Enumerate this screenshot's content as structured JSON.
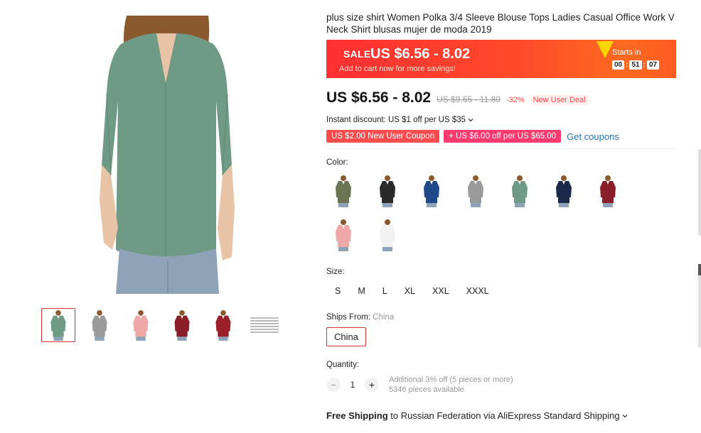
{
  "product": {
    "title": "plus size shirt Women Polka 3/4 Sleeve Blouse Tops Ladies Casual Office Work V Neck Shirt blusas mujer de moda 2019"
  },
  "sale": {
    "tag": "SALE",
    "price": "US $6.56 - 8.02",
    "subtitle": "Add to cart now for more savings!",
    "starts_in": "Starts in",
    "countdown": [
      "00",
      "51",
      "07"
    ]
  },
  "price": {
    "current": "US $6.56 - 8.02",
    "original": "US $9.65 - 11.80",
    "discount": "-32%",
    "deal": "New User Deal"
  },
  "instant_discount": "Instant discount: US $1 off per US $35",
  "coupons": {
    "new_user": "US $2.00 New User Coupon",
    "store": "+ US $6.00 off per US $65.00",
    "get": "Get coupons"
  },
  "color": {
    "label": "Color:",
    "options": [
      {
        "name": "army-green",
        "hex": "#6b7553"
      },
      {
        "name": "black",
        "hex": "#2a2a2a"
      },
      {
        "name": "royal-blue",
        "hex": "#1e4a8a"
      },
      {
        "name": "gray",
        "hex": "#9a9a9a"
      },
      {
        "name": "sage-green",
        "hex": "#6f9a86"
      },
      {
        "name": "navy",
        "hex": "#1b2a4a"
      },
      {
        "name": "wine-red",
        "hex": "#8a1f2a"
      },
      {
        "name": "pink",
        "hex": "#f0a7a7"
      },
      {
        "name": "white",
        "hex": "#f2f2f2"
      }
    ]
  },
  "size": {
    "label": "Size:",
    "options": [
      "S",
      "M",
      "L",
      "XL",
      "XXL",
      "XXXL"
    ]
  },
  "ships_from": {
    "label": "Ships From:",
    "value": "China",
    "button": "China"
  },
  "quantity": {
    "label": "Quantity:",
    "value": "1",
    "minus": "−",
    "plus": "+",
    "offer": "Additional 3% off (5 pieces or more)",
    "available": "5346 pieces available"
  },
  "shipping": {
    "bold": "Free Shipping",
    "rest": " to Russian Federation via AliExpress Standard Shipping"
  },
  "gallery": {
    "main_color": "#6f9a86",
    "thumbs": [
      {
        "name": "sage-green",
        "hex": "#6f9a86"
      },
      {
        "name": "gray",
        "hex": "#9a9a9a"
      },
      {
        "name": "pink",
        "hex": "#f0a7a7"
      },
      {
        "name": "wine-red",
        "hex": "#8a1f2a"
      },
      {
        "name": "red",
        "hex": "#9a1f2a"
      }
    ]
  }
}
